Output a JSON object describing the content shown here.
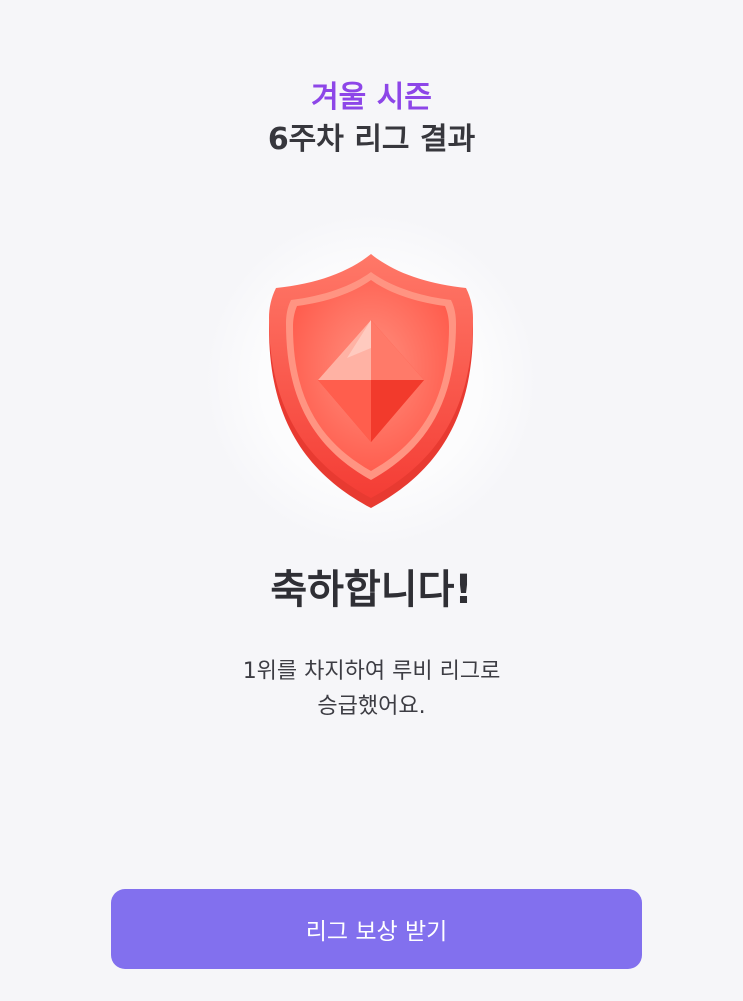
{
  "header": {
    "season": "겨울 시즌",
    "week_result": "6주차 리그 결과"
  },
  "badge": {
    "icon": "ruby-league-shield-icon",
    "color": "#ff5a4b"
  },
  "result": {
    "congrats": "축하합니다!",
    "message_line1": "1위를 차지하여 루비 리그로",
    "message_line2": "승급했어요."
  },
  "actions": {
    "claim_reward_label": "리그 보상 받기"
  },
  "colors": {
    "season_accent": "#8d46e8",
    "button": "#8270ee",
    "background": "#f6f6f9"
  }
}
